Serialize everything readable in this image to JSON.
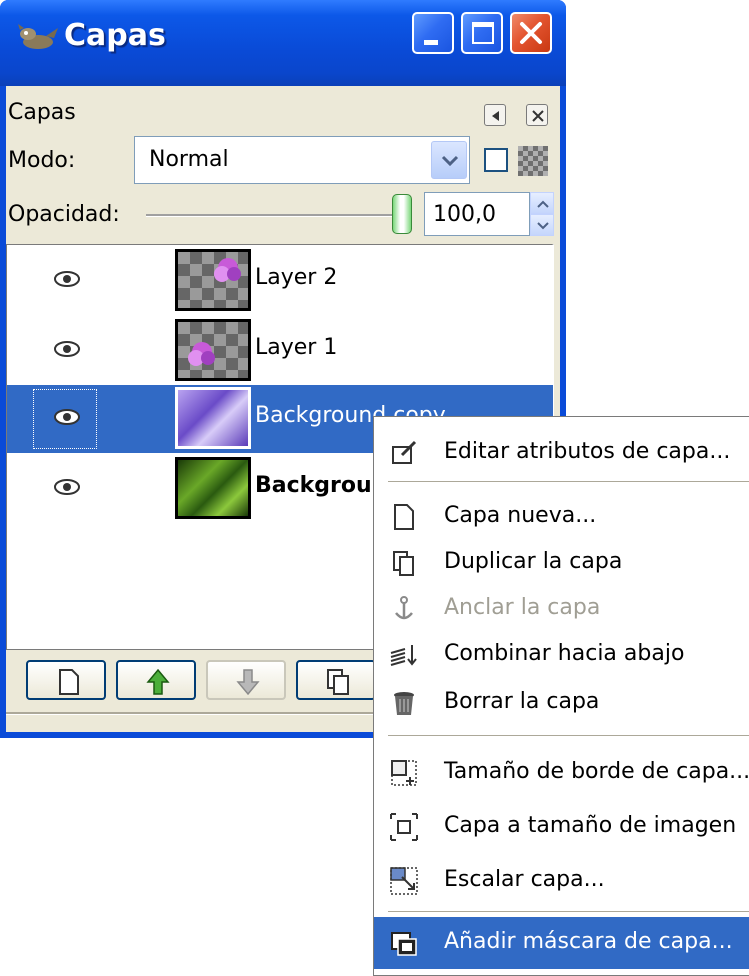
{
  "window": {
    "title": "Capas",
    "colors": {
      "titlebar": "#0a4ad6",
      "client": "#ece9d8",
      "selection": "#316ac5"
    }
  },
  "dialog": {
    "heading": "Capas",
    "mode_label": "Modo:",
    "mode_value": "Normal",
    "opacity_label": "Opacidad:",
    "opacity_value": "100,0"
  },
  "layers": [
    {
      "name": "Layer 2",
      "visible": true,
      "bold": false,
      "selected": false
    },
    {
      "name": "Layer 1",
      "visible": true,
      "bold": false,
      "selected": false
    },
    {
      "name": "Background copy",
      "visible": true,
      "bold": false,
      "selected": true
    },
    {
      "name": "Background",
      "visible": true,
      "bold": true,
      "selected": false
    }
  ],
  "bottom_buttons": [
    {
      "icon": "new-layer-icon",
      "enabled": true
    },
    {
      "icon": "raise-layer-icon",
      "enabled": true
    },
    {
      "icon": "lower-layer-icon",
      "enabled": false
    },
    {
      "icon": "duplicate-layer-icon",
      "enabled": true
    }
  ],
  "context_menu": {
    "items": [
      {
        "label": "Editar atributos de capa...",
        "icon": "edit-attributes-icon",
        "enabled": true
      },
      {
        "label": "Capa nueva...",
        "icon": "new-layer-icon",
        "enabled": true
      },
      {
        "label": "Duplicar la capa",
        "icon": "duplicate-layer-icon",
        "enabled": true
      },
      {
        "label": "Anclar la capa",
        "icon": "anchor-icon",
        "enabled": false
      },
      {
        "label": "Combinar hacia abajo",
        "icon": "merge-down-icon",
        "enabled": true
      },
      {
        "label": "Borrar la capa",
        "icon": "trash-icon",
        "enabled": true
      },
      {
        "label": "Tamaño de borde de capa...",
        "icon": "layer-boundary-size-icon",
        "enabled": true
      },
      {
        "label": "Capa a tamaño de imagen",
        "icon": "layer-to-image-size-icon",
        "enabled": true
      },
      {
        "label": "Escalar capa...",
        "icon": "scale-layer-icon",
        "enabled": true
      },
      {
        "label": "Añadir máscara de capa...",
        "icon": "add-layer-mask-icon",
        "enabled": true,
        "highlighted": true
      }
    ]
  }
}
